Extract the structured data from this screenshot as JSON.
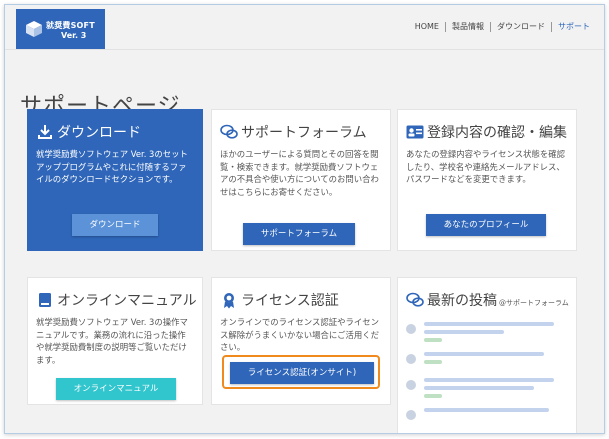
{
  "header": {
    "logo": {
      "line1": "就奨費SOFT",
      "line2": "Ver. 3"
    },
    "nav": [
      {
        "label": "HOME",
        "active": false
      },
      {
        "label": "製品情報",
        "active": false
      },
      {
        "label": "ダウンロード",
        "active": false
      },
      {
        "label": "サポート",
        "active": true
      }
    ]
  },
  "page": {
    "title": "サポートページ"
  },
  "cards": {
    "download": {
      "title": "ダウンロード",
      "desc": "就学奨励費ソフトウェア Ver. 3のセットアッププログラムやこれに付随するファイルのダウンロードセクションです。",
      "button": "ダウンロード",
      "icon": "download-icon"
    },
    "forum": {
      "title": "サポートフォーラム",
      "desc": "ほかのユーザーによる質問とその回答を閲覧・検索できます。就学奨励費ソフトウェアの不具合や使い方についてのお問い合わせはこちらにお寄せください。",
      "button": "サポートフォーラム",
      "icon": "chat-bubbles-icon"
    },
    "profile": {
      "title": "登録内容の確認・編集",
      "desc": "あなたの登録内容やライセンス状態を確認したり、学校名や連絡先メールアドレス、パスワードなどを変更できます。",
      "button": "あなたのプロフィール",
      "icon": "id-card-icon"
    },
    "manual": {
      "title": "オンラインマニュアル",
      "desc": "就学奨励費ソフトウェア Ver. 3の操作マニュアルです。業務の流れに沿った操作や就学奨励費制度の説明等ご覧いただけます。",
      "button": "オンラインマニュアル",
      "icon": "book-icon"
    },
    "license": {
      "title": "ライセンス認証",
      "desc": "オンラインでのライセンス認証やライセンス解除がうまくいかない場合にご活用ください。",
      "button": "ライセンス認証(オンサイト)",
      "icon": "award-ribbon-icon"
    },
    "latest": {
      "title": "最新の投稿",
      "subtitle": "@サポートフォーラム",
      "icon": "chat-bubbles-icon"
    }
  },
  "colors": {
    "brand": "#2f66b9",
    "button_light": "#5b92d8",
    "teal": "#31c5cd",
    "highlight": "#f08a1d"
  }
}
